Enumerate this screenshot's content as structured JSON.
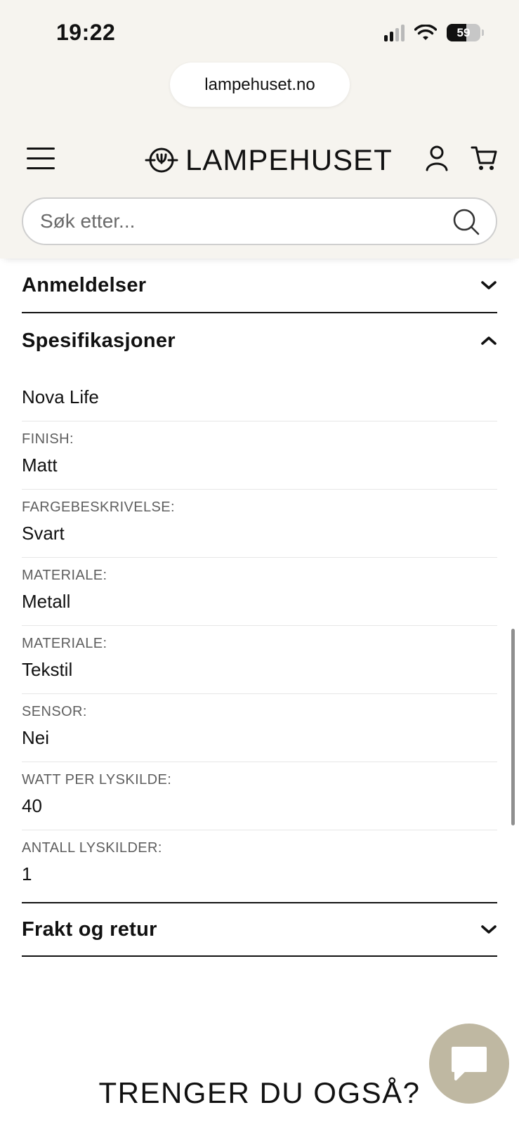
{
  "status_bar": {
    "time": "19:22",
    "battery_percent": "59",
    "signal_bars_active": 2,
    "icons": [
      "signal-icon",
      "wifi-icon",
      "battery-icon"
    ]
  },
  "browser": {
    "url": "lampehuset.no"
  },
  "header": {
    "logo_text": "LAMPEHUSET",
    "icons": [
      "menu-icon",
      "logo-icon",
      "account-icon",
      "cart-icon"
    ]
  },
  "search": {
    "placeholder": "Søk etter...",
    "value": ""
  },
  "accordion": {
    "reviews_title": "Anmeldelser",
    "specs_title": "Spesifikasjoner",
    "shipping_title": "Frakt og retur"
  },
  "specs": {
    "brand": "Nova Life",
    "items": [
      {
        "label": "FINISH:",
        "value": "Matt"
      },
      {
        "label": "FARGEBESKRIVELSE:",
        "value": "Svart"
      },
      {
        "label": "MATERIALE:",
        "value": "Metall"
      },
      {
        "label": "MATERIALE:",
        "value": "Tekstil"
      },
      {
        "label": "SENSOR:",
        "value": "Nei"
      },
      {
        "label": "WATT PER LYSKILDE:",
        "value": "40"
      },
      {
        "label": "ANTALL LYSKILDER:",
        "value": "1"
      }
    ]
  },
  "recommend": {
    "title": "TRENGER DU OGSÅ?"
  },
  "colors": {
    "chrome_bg": "#f6f4ef",
    "chat_button": "#bfb8a2",
    "text": "#111111",
    "label_gray": "#5f5f5f"
  }
}
